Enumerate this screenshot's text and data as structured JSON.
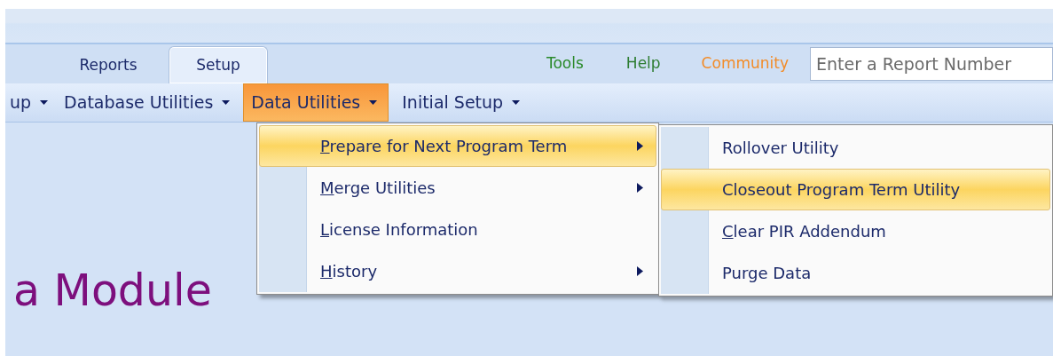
{
  "tabs": [
    {
      "label": "Reports",
      "selected": false
    },
    {
      "label": "Setup",
      "selected": true
    }
  ],
  "top_links": [
    {
      "label": "Tools",
      "color": "#2a8a2a"
    },
    {
      "label": "Help",
      "color": "#2e7d32"
    },
    {
      "label": "Community",
      "color": "#f28c28"
    }
  ],
  "report_search": {
    "placeholder": "Enter a Report Number"
  },
  "toolbar": [
    {
      "label": "up",
      "selected": false
    },
    {
      "label": "Database Utilities",
      "selected": false
    },
    {
      "label": "Data Utilities",
      "selected": true
    },
    {
      "label": "Initial Setup",
      "selected": false
    }
  ],
  "menu": [
    {
      "mnemonic": "P",
      "rest": "repare for Next Program Term",
      "selected": true,
      "submenu": true
    },
    {
      "mnemonic": "M",
      "rest": "erge Utilities",
      "selected": false,
      "submenu": true
    },
    {
      "mnemonic": "L",
      "rest": "icense Information",
      "selected": false,
      "submenu": false
    },
    {
      "mnemonic": "H",
      "rest": "istory",
      "selected": false,
      "submenu": true
    }
  ],
  "submenu": [
    {
      "label": "Rollover Utility",
      "selected": false
    },
    {
      "label": "Closeout Program Term Utility",
      "selected": true
    },
    {
      "mnemonic": "C",
      "rest": "lear PIR Addendum",
      "selected": false
    },
    {
      "label": "Purge Data",
      "selected": false
    }
  ],
  "heading": "a Module"
}
